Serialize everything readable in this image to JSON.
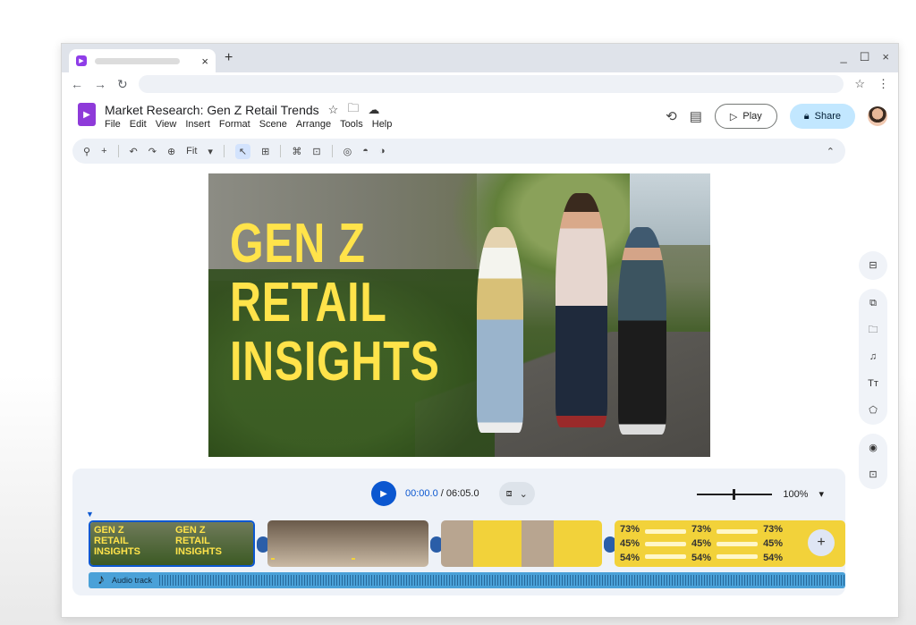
{
  "browser": {
    "tab_close": "×",
    "new_tab": "+",
    "window_controls": [
      "_",
      "☐",
      "×"
    ],
    "nav": [
      "←",
      "→",
      "↻"
    ]
  },
  "app": {
    "doc_title": "Market Research: Gen Z Retail Trends",
    "menu": [
      "File",
      "Edit",
      "View",
      "Insert",
      "Format",
      "Scene",
      "Arrange",
      "Tools",
      "Help"
    ],
    "play_label": "Play",
    "share_label": "Share"
  },
  "toolbar": {
    "zoom_fit": "Fit"
  },
  "slide": {
    "headline_lines": [
      "GEN Z",
      "RETAIL",
      "INSIGHTS"
    ]
  },
  "timeline": {
    "current_time": "00:00.0",
    "total_time": "06:05.0",
    "zoom_level": "100%",
    "clip1_text": [
      "GEN Z",
      "RETAIL",
      "INSIGHTS"
    ],
    "clip4_stats": [
      "73%",
      "45%",
      "54%"
    ],
    "audio_label": "Audio track"
  },
  "colors": {
    "brand_purple": "#8e3ad9",
    "accent_blue": "#0b57d0",
    "headline_yellow": "#ffe34a",
    "share_bg": "#c2e7ff"
  }
}
